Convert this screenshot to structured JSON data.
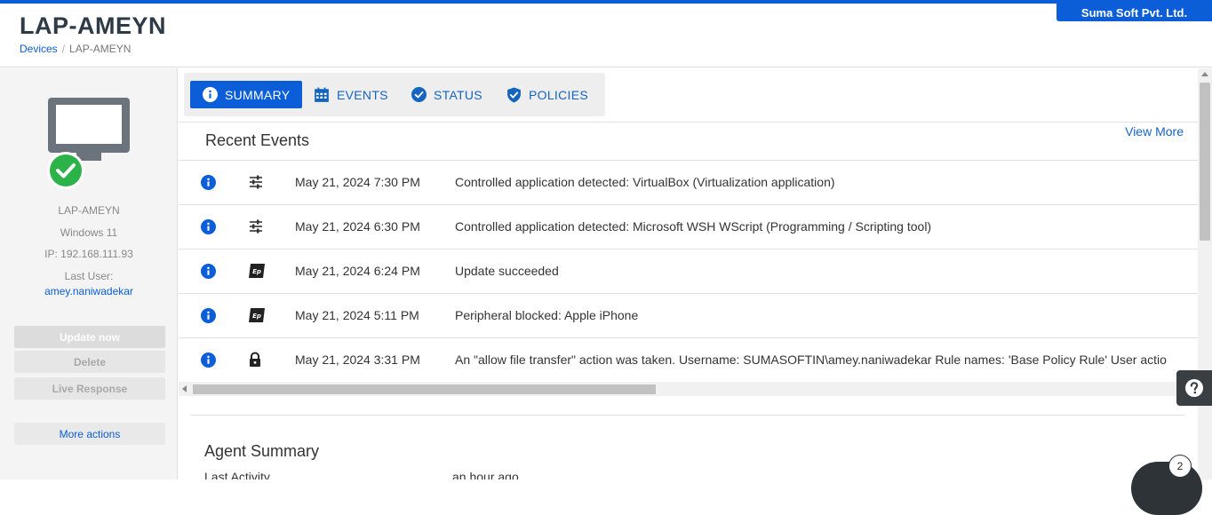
{
  "header": {
    "title": "LAP-AMEYN",
    "org": "Suma Soft Pvt. Ltd.",
    "breadcrumb": [
      {
        "label": "Devices"
      },
      {
        "label": "LAP-AMEYN"
      }
    ]
  },
  "sidebar": {
    "device_name": "LAP-AMEYN",
    "os": "Windows 11",
    "ip": "IP: 192.168.111.93",
    "last_user_label": "Last User:",
    "last_user": "amey.naniwadekar",
    "buttons": {
      "update": "Update now",
      "delete": "Delete",
      "live_response": "Live Response",
      "more_actions": "More actions"
    },
    "status_color": "#2bb34a"
  },
  "tabs": [
    {
      "label": "SUMMARY",
      "icon": "info-icon",
      "active": true
    },
    {
      "label": "EVENTS",
      "icon": "calendar-icon",
      "active": false
    },
    {
      "label": "STATUS",
      "icon": "check-circle-icon",
      "active": false
    },
    {
      "label": "POLICIES",
      "icon": "shield-check-icon",
      "active": false
    }
  ],
  "recent_events": {
    "title": "Recent Events",
    "view_more": "View More",
    "rows": [
      {
        "type_icon": "sliders-icon",
        "time": "May 21, 2024 7:30 PM",
        "message": "Controlled application detected: VirtualBox (Virtualization application)"
      },
      {
        "type_icon": "sliders-icon",
        "time": "May 21, 2024 6:30 PM",
        "message": "Controlled application detected: Microsoft WSH WScript (Programming / Scripting tool)"
      },
      {
        "type_icon": "ep-icon",
        "time": "May 21, 2024 6:24 PM",
        "message": "Update succeeded"
      },
      {
        "type_icon": "ep-icon",
        "time": "May 21, 2024 5:11 PM",
        "message": "Peripheral blocked: Apple iPhone"
      },
      {
        "type_icon": "lock-icon",
        "time": "May 21, 2024 3:31 PM",
        "message": "An \"allow file transfer\" action was taken. Username: SUMASOFTIN\\amey.naniwadekar Rule names: 'Base Policy Rule' User actio"
      }
    ]
  },
  "agent_summary": {
    "title": "Agent Summary",
    "last_activity_label": "Last Activity",
    "last_activity_value": "an hour ago"
  },
  "chat": {
    "badge": "2"
  },
  "colors": {
    "accent": "#0b5ed7",
    "link": "#1565c0"
  }
}
